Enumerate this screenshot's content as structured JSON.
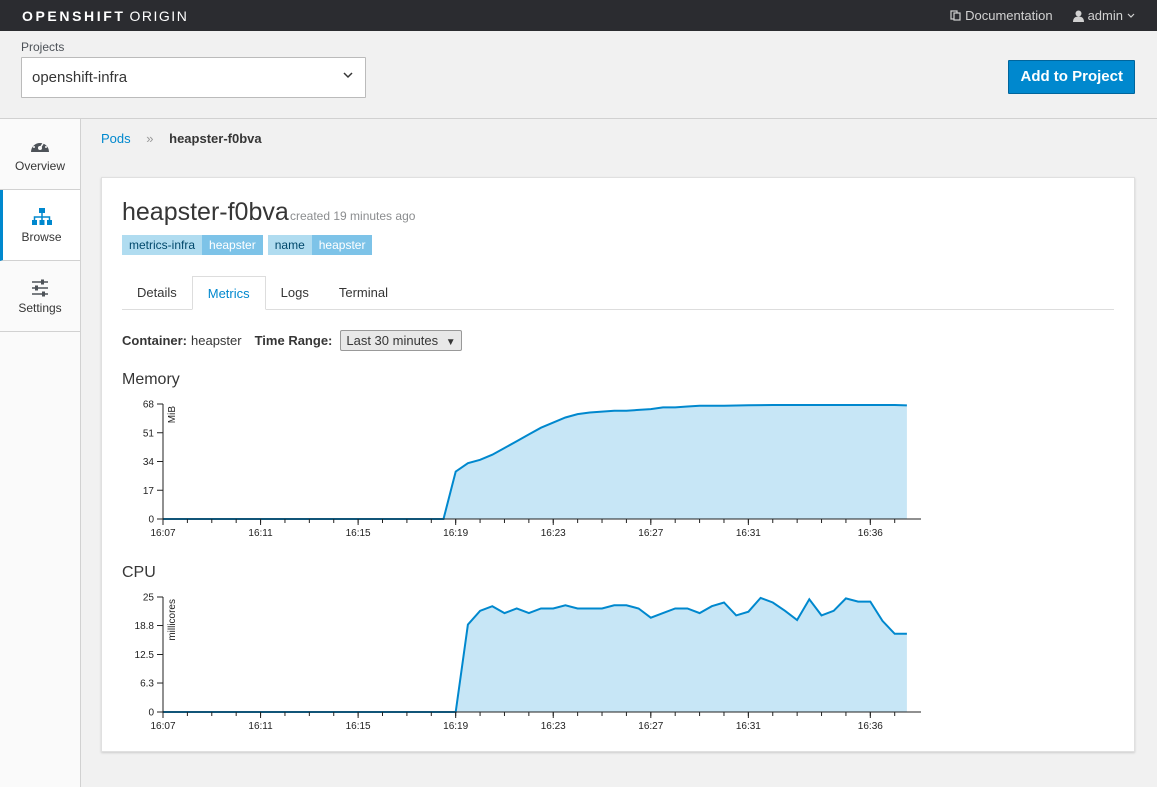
{
  "app": {
    "brand_bold": "OPENSHIFT",
    "brand_thin": "ORIGIN",
    "documentation": "Documentation",
    "user": "admin"
  },
  "projects": {
    "label": "Projects",
    "selected": "openshift-infra",
    "add_button": "Add to Project"
  },
  "sidebar": {
    "items": [
      {
        "label": "Overview",
        "icon": "dashboard-icon",
        "active": false
      },
      {
        "label": "Browse",
        "icon": "sitemap-icon",
        "active": true
      },
      {
        "label": "Settings",
        "icon": "sliders-icon",
        "active": false
      }
    ]
  },
  "breadcrumb": {
    "parent": "Pods",
    "separator": "»",
    "current": "heapster-f0bva"
  },
  "pod": {
    "name": "heapster-f0bva",
    "created": "created 19 minutes ago",
    "labels": [
      {
        "key": "metrics-infra",
        "value": "heapster"
      },
      {
        "key": "name",
        "value": "heapster"
      }
    ]
  },
  "tabs": [
    "Details",
    "Metrics",
    "Logs",
    "Terminal"
  ],
  "active_tab": "Metrics",
  "metrics": {
    "container_label": "Container:",
    "container": "heapster",
    "time_range_label": "Time Range:",
    "time_range": "Last 30 minutes"
  },
  "colors": {
    "accent": "#0088ce",
    "line": "#0088ce",
    "fill": "#c7e6f6"
  },
  "chart_data": [
    {
      "type": "area",
      "title": "Memory",
      "ylabel": "MiB",
      "yticks": [
        "0",
        "17",
        "34",
        "51",
        "68"
      ],
      "ylim": [
        0,
        68
      ],
      "xlim": [
        "16:07",
        "16:37:45"
      ],
      "xticks": [
        "16:07",
        "16:11",
        "16:15",
        "16:19",
        "16:23",
        "16:27",
        "16:31",
        "16:36"
      ],
      "x": [
        "16:07",
        "16:18:30",
        "16:19",
        "16:19:30",
        "16:20",
        "16:20:30",
        "16:21",
        "16:21:30",
        "16:22",
        "16:22:30",
        "16:23",
        "16:23:30",
        "16:24",
        "16:24:30",
        "16:25",
        "16:25:30",
        "16:26",
        "16:26:30",
        "16:27",
        "16:27:30",
        "16:28",
        "16:28:30",
        "16:29",
        "16:30",
        "16:31",
        "16:32",
        "16:33",
        "16:34",
        "16:35",
        "16:36",
        "16:37",
        "16:37:30"
      ],
      "values": [
        0,
        0,
        28,
        33,
        35,
        38,
        42,
        46,
        50,
        54,
        57,
        60,
        62,
        63,
        63.5,
        64,
        64,
        64.5,
        65,
        66,
        66,
        66.5,
        67,
        67,
        67.3,
        67.4,
        67.4,
        67.4,
        67.4,
        67.4,
        67.4,
        67.2
      ]
    },
    {
      "type": "area",
      "title": "CPU",
      "ylabel": "millicores",
      "yticks": [
        "0",
        "6.3",
        "12.5",
        "18.8",
        "25"
      ],
      "ylim": [
        0,
        25
      ],
      "xlim": [
        "16:07",
        "16:37:45"
      ],
      "xticks": [
        "16:07",
        "16:11",
        "16:15",
        "16:19",
        "16:23",
        "16:27",
        "16:31",
        "16:36"
      ],
      "x": [
        "16:07",
        "16:19",
        "16:19:30",
        "16:20",
        "16:20:30",
        "16:21",
        "16:21:30",
        "16:22",
        "16:22:30",
        "16:23",
        "16:23:30",
        "16:24",
        "16:24:30",
        "16:25",
        "16:25:30",
        "16:26",
        "16:26:30",
        "16:27",
        "16:27:30",
        "16:28",
        "16:28:30",
        "16:29",
        "16:29:30",
        "16:30",
        "16:30:30",
        "16:31",
        "16:31:30",
        "16:32",
        "16:32:30",
        "16:33",
        "16:33:30",
        "16:34",
        "16:34:30",
        "16:35",
        "16:35:30",
        "16:36",
        "16:36:30",
        "16:37",
        "16:37:30"
      ],
      "values": [
        0,
        0,
        19,
        22,
        23,
        21.5,
        22.5,
        21.5,
        22.5,
        22.5,
        23.2,
        22.5,
        22.5,
        22.5,
        23.2,
        23.2,
        22.5,
        20.5,
        21.5,
        22.5,
        22.5,
        21.5,
        23,
        23.8,
        21,
        21.8,
        24.8,
        23.8,
        22,
        20,
        24.5,
        21,
        22,
        24.7,
        24,
        24,
        19.8,
        17,
        17
      ]
    }
  ]
}
